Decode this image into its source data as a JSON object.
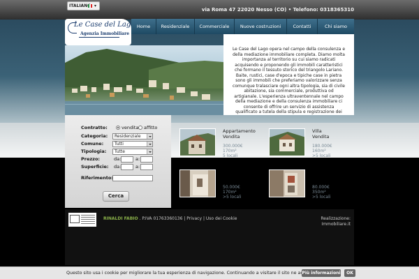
{
  "header": {
    "language": "ITALIANO",
    "address": "via Roma 47 22020 Nesso (CO)",
    "separator": "•",
    "phone_label": "Telefono:",
    "phone": "0318365310"
  },
  "logo": {
    "title": "Le Case del Lago",
    "subtitle": "Agenzia Immobiliare"
  },
  "nav": {
    "items": [
      "Home",
      "Residenziale",
      "Commerciale",
      "Nuove costruzioni",
      "Contatti",
      "Chi siamo"
    ]
  },
  "intro": {
    "text": "Le Case del Lago opera nel campo della consulenza e della mediazione immobiliare completa. Diamo molta importanza al territorio su cui siamo radicati acquisendo e proponendo gli immobili caratteristici che formano il tessuto storico del triangolo Lariano. Baite, rustici, case d'epoca e tipiche case in pietra sono gli immobili che preferiamo valorizzare senza comunque tralasciare ogni altra tipologia, sia di civile abitazione, sia commerciale, produttiva od artigianale. L'esperienza ultraventennale nel campo della mediazione e della consulenza immobiliare ci consente di offrire un servizio di assistenza qualificato a tutela della stipula e registrazione dei vostri contratti di"
  },
  "search": {
    "contratto_label": "Contratto:",
    "vendita": "vendita",
    "affitto": "affitto",
    "contratto_selected": "vendita",
    "categoria_label": "Categoria:",
    "categoria_value": "Residenziale",
    "comune_label": "Comune:",
    "comune_value": "Tutti",
    "tipologia_label": "Tipologia:",
    "tipologia_value": "Tutte",
    "prezzo_label": "Prezzo:",
    "superficie_label": "Superficie:",
    "da": "da:",
    "a": "a:",
    "riferimento_label": "Riferimento:",
    "button": "Cerca"
  },
  "listings": [
    {
      "title": "Appartamento",
      "subtitle": "Vendita",
      "price": "300.000€",
      "area": "170m²",
      "rooms": "5 locali"
    },
    {
      "title": "Villa",
      "subtitle": "Vendita",
      "price": "180.000€",
      "area": "160m²",
      "rooms": ">5 locali"
    },
    {
      "title": "",
      "subtitle": "",
      "price": "50.000€",
      "area": "170m²",
      "rooms": ">5 locali"
    },
    {
      "title": "",
      "subtitle": "",
      "price": "80.000€",
      "area": "350m²",
      "rooms": ">5 locali"
    }
  ],
  "footer": {
    "name": "RINALDI FABIO",
    "piva": ". P.IVA 01763360136 |",
    "privacy": "Privacy",
    "sep": "|",
    "cookies": "Uso dei Cookie",
    "realizzazione": "Realizzazione:",
    "realizzazione_by": "Immobiliare.it"
  },
  "cookie_bar": {
    "text": "Questo sito usa i cookie per migliorare la tua esperienza di navigazione. Continuando a visitare il sito ne accetti l'uso.",
    "more": "Più informazioni",
    "ok": "OK"
  },
  "colors": {
    "nav_bg": "#2f5c77",
    "footer_name": "#8bb24a",
    "listing_meta": "#7a8a96"
  }
}
